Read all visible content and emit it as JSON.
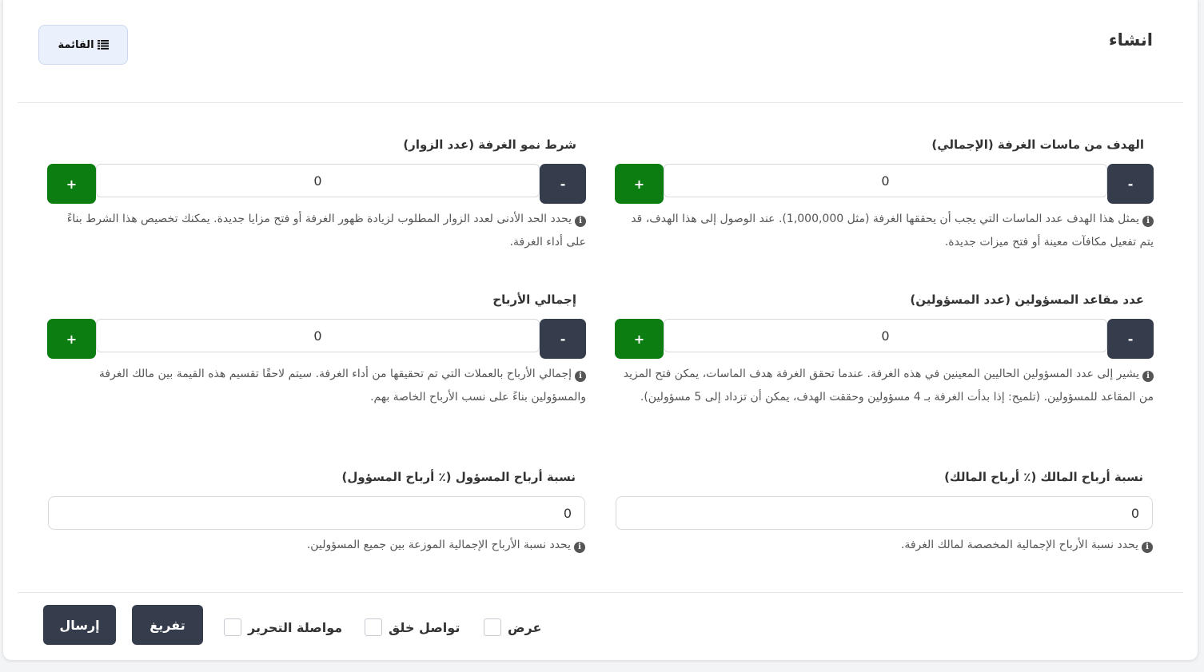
{
  "header": {
    "title": "انشاء",
    "list_button_label": "القائمة",
    "list_button_icon": "list-icon"
  },
  "fields": {
    "diamond_goal": {
      "label": "الهدف من ماسات الغرفة (الإجمالي)",
      "value": "0",
      "minus": "-",
      "plus": "+",
      "help": "يمثل هذا الهدف عدد الماسات التي يجب أن يحققها الغرفة (مثل 1,000,000). عند الوصول إلى هذا الهدف، قد يتم تفعيل مكافآت معينة أو فتح ميزات جديدة."
    },
    "growth_condition": {
      "label": "شرط نمو الغرفة (عدد الزوار)",
      "value": "0",
      "minus": "-",
      "plus": "+",
      "help": "يحدد الحد الأدنى لعدد الزوار المطلوب لزيادة ظهور الغرفة أو فتح مزايا جديدة. يمكنك تخصيص هذا الشرط بناءً على أداء الغرفة."
    },
    "admin_seats": {
      "label": "عدد مقاعد المسؤولين (عدد المسؤولين)",
      "value": "0",
      "minus": "-",
      "plus": "+",
      "help": "يشير إلى عدد المسؤولين الحاليين المعينين في هذه الغرفة. عندما تحقق الغرفة هدف الماسات، يمكن فتح المزيد من المقاعد للمسؤولين. (تلميح: إذا بدأت الغرفة بـ 4 مسؤولين وحققت الهدف، يمكن أن تزداد إلى 5 مسؤولين)."
    },
    "total_profit": {
      "label": "إجمالي الأرباح",
      "value": "0",
      "minus": "-",
      "plus": "+",
      "help": "إجمالي الأرباح بالعملات التي تم تحقيقها من أداء الغرفة. سيتم لاحقًا تقسيم هذه القيمة بين مالك الغرفة والمسؤولين بناءً على نسب الأرباح الخاصة بهم."
    },
    "owner_share": {
      "label": "نسبة أرباح المالك (٪ أرباح المالك)",
      "value": "0",
      "help": "يحدد نسبة الأرباح الإجمالية المخصصة لمالك الغرفة."
    },
    "admin_share": {
      "label": "نسبة أرباح المسؤول (٪ أرباح المسؤول)",
      "value": "0",
      "help": "يحدد نسبة الأرباح الإجمالية الموزعة بين جميع المسؤولين."
    }
  },
  "footer": {
    "submit_label": "إرسال",
    "reset_label": "تفريغ",
    "checks": {
      "view": "عرض",
      "continue_create": "تواصل خلق",
      "continue_edit": "مواصلة التحرير"
    }
  },
  "colors": {
    "dark_button": "#353c4c",
    "plus_button": "#0b7d11",
    "list_button_bg": "#eaf0fc"
  }
}
